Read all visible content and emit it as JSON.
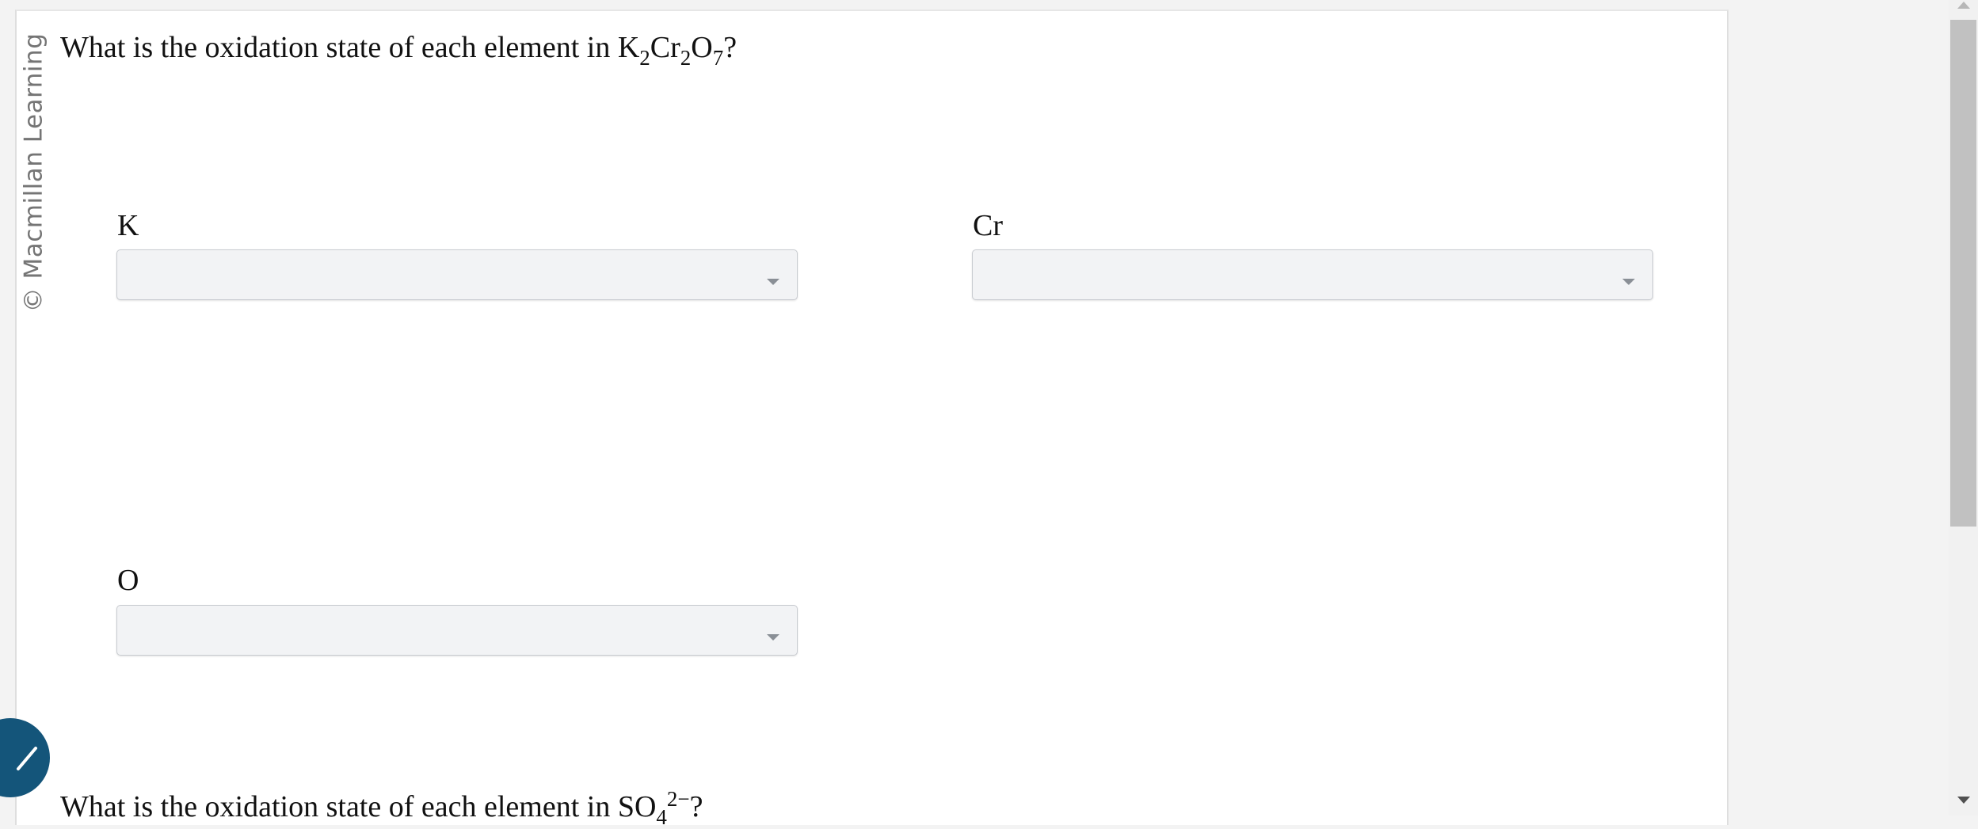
{
  "watermark": "© Macmillan Learning",
  "question1": {
    "prefix": "What is the oxidation state of each element in ",
    "formula": [
      {
        "text": "K",
        "sub": "2"
      },
      {
        "text": "Cr",
        "sub": "2"
      },
      {
        "text": "O",
        "sub": "7"
      }
    ],
    "suffix": "?"
  },
  "fields": {
    "k": {
      "label": "K",
      "value": ""
    },
    "cr": {
      "label": "Cr",
      "value": ""
    },
    "o": {
      "label": "O",
      "value": ""
    }
  },
  "question2": {
    "prefix": "What is the oxidation state of each element in ",
    "formula_main": "SO",
    "formula_sub": "4",
    "formula_sup": "2−",
    "suffix": "?"
  },
  "icons": {
    "fab": "pencil-icon",
    "fab_color": "#14557a"
  }
}
